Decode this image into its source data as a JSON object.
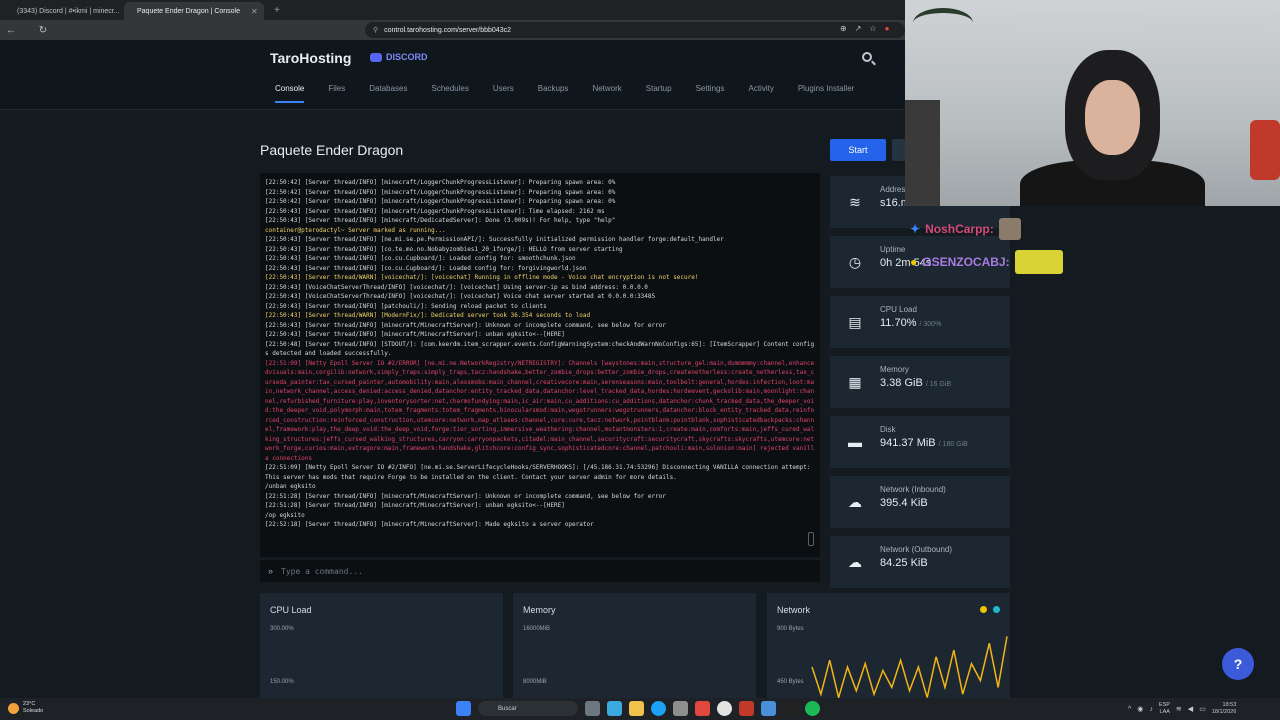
{
  "browser": {
    "tabs": [
      {
        "label": "(3343) Discord | #•ikmi | minecr...",
        "active": false
      },
      {
        "label": "Paquete Ender Dragon | Console",
        "active": true
      }
    ],
    "url": "control.tarohosting.com/server/bbb043c2"
  },
  "header": {
    "brand": "TaroHosting",
    "discord": "DISCORD",
    "search_icon": "search-icon"
  },
  "nav": [
    "Console",
    "Files",
    "Databases",
    "Schedules",
    "Users",
    "Backups",
    "Network",
    "Startup",
    "Settings",
    "Activity",
    "Plugins Installer"
  ],
  "nav_active": "Console",
  "page": {
    "title": "Paquete Ender Dragon",
    "start_label": "Start"
  },
  "console": {
    "lines": [
      {
        "t": "[22:50:42] [Server thread/INFO] [minecraft/LoggerChunkProgressListener]: Preparing spawn area: 0%",
        "c": ""
      },
      {
        "t": "[22:50:42] [Server thread/INFO] [minecraft/LoggerChunkProgressListener]: Preparing spawn area: 0%",
        "c": ""
      },
      {
        "t": "[22:50:42] [Server thread/INFO] [minecraft/LoggerChunkProgressListener]: Preparing spawn area: 0%",
        "c": ""
      },
      {
        "t": "[22:50:43] [Server thread/INFO] [minecraft/LoggerChunkProgressListener]: Time elapsed: 2162 ms",
        "c": ""
      },
      {
        "t": "[22:50:43] [Server thread/INFO] [minecraft/DedicatedServer]: Done (3.009s)! For help, type \"help\"",
        "c": ""
      },
      {
        "t": "container@pterodactyl~ Server marked as running...",
        "c": "warn"
      },
      {
        "t": "[22:50:43] [Server thread/INFO] [ne.mi.se.pe.PermissionAPI/]: Successfully initialized permission handler forge:default_handler",
        "c": ""
      },
      {
        "t": "[22:50:43] [Server thread/INFO] [co.te.mo.no.Nobabyzombies1_20_1forge/]: HELLO from server starting",
        "c": ""
      },
      {
        "t": "[22:50:43] [Server thread/INFO] [co.cu.Cupboard/]: Loaded config for: smoothchunk.json",
        "c": ""
      },
      {
        "t": "[22:50:43] [Server thread/INFO] [co.cu.Cupboard/]: Loaded config for: forgivingworld.json",
        "c": ""
      },
      {
        "t": "[22:50:43] [Server thread/WARN] [voicechat/]: [voicechat] Running in offline mode - Voice chat encryption is not secure!",
        "c": "warn"
      },
      {
        "t": "[22:50:43] [VoiceChatServerThread/INFO] [voicechat/]: [voicechat] Using server-ip as bind address: 0.0.0.0",
        "c": ""
      },
      {
        "t": "[22:50:43] [VoiceChatServerThread/INFO] [voicechat/]: [voicechat] Voice chat server started at 0.0.0.0:33485",
        "c": ""
      },
      {
        "t": "[22:50:43] [Server thread/INFO] [patchouli/]: Sending reload packet to clients",
        "c": ""
      },
      {
        "t": "[22:50:43] [Server thread/WARN] [ModernFix/]: Dedicated server took 36.354 seconds to load",
        "c": "warn"
      },
      {
        "t": "[22:50:43] [Server thread/INFO] [minecraft/MinecraftServer]: Unknown or incomplete command, see below for error",
        "c": ""
      },
      {
        "t": "[22:50:43] [Server thread/INFO] [minecraft/MinecraftServer]: unban egksito<--[HERE]",
        "c": ""
      },
      {
        "t": "[22:50:48] [Server thread/INFO] [STDOUT/]: [com.keerdm.item_scrapper.events.ConfigWarningSystem:checkAndWarnNoConfigs:65]: [ItemScrapper] Content configs detected and loaded successfully.",
        "c": ""
      },
      {
        "t": "[22:51:09] [Netty Epoll Server IO #2/ERROR] [ne.mi.ne.NetworkRegistry/NETREGISTRY]: Channels [waystones:main,structure_gel:main,dummmmmy:channel,enhancedvisuals:main,corgilib:network,simply_traps:simply_traps,tacz:handshake,better_zombie_drops:better_zombie_drops,createnetherless:create_netherless,tax_curseda_painter:tax_cursed_painter,automobility:main,alexsmobs:main_channel,creativecore:main,serenseasons:main,toolbelt:general,hordes:infection,loot:main,network_channel,access_denied:access_denied,datanchor:entity_tracked_data,datanchor:level_tracked_data,hordes:hordeevent,geckolib:main,moonlight:channel,refurbished_furniture:play,inventorysorter:net,charmofundying:main,ic_air:main,cu_additions:cu_additions,datanchor:chunk_tracked_data,the_deeper_void:the_deeper_void,polymorph:main,totem_fragments:totem_fragments,binocularsmod:main,wegotrunners:wegotrunners,datanchor:block_entity_tracked_data,reinforced_construction:reinforced_construction,utemcore:network,map_atlases:channel,cure:cure,tacz:network,pointblank:pointblank,sophisticatedbackpacks:channel,framework:play,the_deep_void:the_deep_void,forge:tier_sorting,immersive_weathering:channel,mutantmonsters:1,create:main,comforts:main,jeffs_cured_walking_structures:jeffs_cursed_walking_structures,carryon:carryonpackets,citadel:main_channel,securitycraft:securitycraft,skycrafts:skycrafts,utemcore:network_forge,curios:main,extragore:main,framework:handshake,glitchcore:config_sync,sophisticatedcore:channel,patchouli:main,solonion:main] rejected vanilla connections",
        "c": "err"
      },
      {
        "t": "[22:51:09] [Netty Epoll Server IO #2/INFO] [ne.mi.se.ServerLifecycleHooks/SERVERHOOKS]: [/45.186.31.74:53296] Disconnecting VANILLA connection attempt: This server has mods that require Forge to be installed on the client. Contact your server admin for more details.",
        "c": ""
      },
      {
        "t": "/unban egksito",
        "c": ""
      },
      {
        "t": "[22:51:28] [Server thread/INFO] [minecraft/MinecraftServer]: Unknown or incomplete command, see below for error",
        "c": ""
      },
      {
        "t": "[22:51:28] [Server thread/INFO] [minecraft/MinecraftServer]: unban egksito<--[HERE]",
        "c": ""
      },
      {
        "t": "/op egksito",
        "c": ""
      },
      {
        "t": "[22:52:18] [Server thread/INFO] [minecraft/MinecraftServer]: Made egksito a server operator",
        "c": ""
      }
    ],
    "command_placeholder": "Type a command..."
  },
  "stats": [
    {
      "icon": "wifi-icon",
      "label": "Address",
      "value": "s16.mia",
      "sub": ""
    },
    {
      "icon": "clock-icon",
      "label": "Uptime",
      "value": "0h 2m 54s",
      "sub": ""
    },
    {
      "icon": "cpu-icon",
      "label": "CPU Load",
      "value": "11.70%",
      "sub": "/ 300%"
    },
    {
      "icon": "memory-icon",
      "label": "Memory",
      "value": "3.38 GiB",
      "sub": "/ 16 GiB"
    },
    {
      "icon": "disk-icon",
      "label": "Disk",
      "value": "941.37 MiB",
      "sub": "/ 180 GiB"
    },
    {
      "icon": "cloud-download-icon",
      "label": "Network (Inbound)",
      "value": "395.4 KiB",
      "sub": ""
    },
    {
      "icon": "cloud-upload-icon",
      "label": "Network (Outbound)",
      "value": "84.25 KiB",
      "sub": ""
    }
  ],
  "graphs": [
    {
      "title": "CPU Load",
      "ticks": [
        "300.00%",
        "150.00%"
      ]
    },
    {
      "title": "Memory",
      "ticks": [
        "16000MiB",
        "8000MiB"
      ]
    },
    {
      "title": "Network",
      "ticks": [
        "900 Bytes",
        "450 Bytes"
      ],
      "series": [
        {
          "values": [
            0.5,
            0.1,
            0.6,
            0.05,
            0.5,
            0.15,
            0.55,
            0.1,
            0.45,
            0.2,
            0.6,
            0.15,
            0.5,
            0.05,
            0.65,
            0.2,
            0.75,
            0.1,
            0.55,
            0.3,
            0.85,
            0.2,
            0.95
          ]
        }
      ]
    }
  ],
  "colors": {
    "accent": "#2563eb",
    "graph_line": "#f2b515",
    "legend_yellow": "#f2c300",
    "legend_cyan": "#22b8cf"
  },
  "overlay": {
    "chat": [
      {
        "user": "NoshCarpp:"
      },
      {
        "user": "GSENZOCABJ:"
      }
    ]
  },
  "help_label": "?",
  "taskbar": {
    "weather_temp": "23°C",
    "weather_desc": "Soleado",
    "search": "Buscar",
    "lang": "ESP",
    "lang2": "LAA",
    "time": "18:53",
    "date": "18/1/2026"
  }
}
